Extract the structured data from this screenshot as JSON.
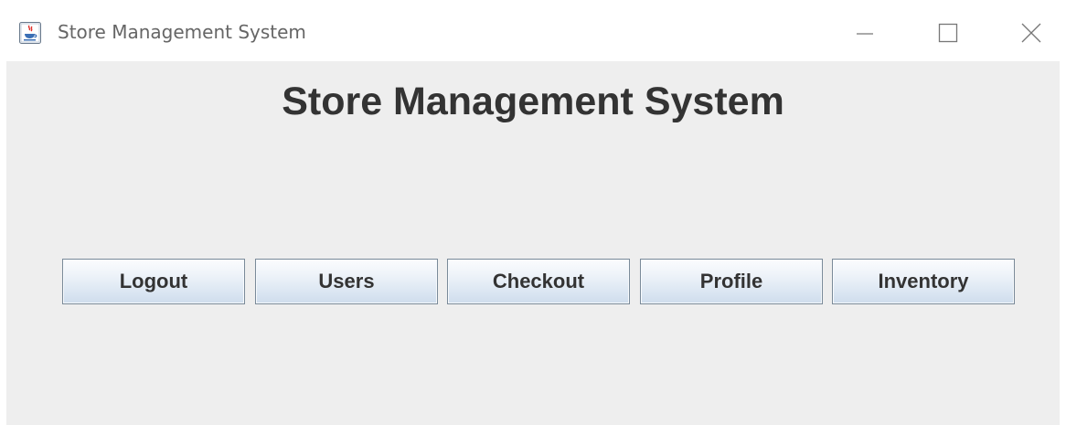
{
  "window": {
    "title": "Store Management System",
    "app_icon": "java-icon",
    "controls": {
      "minimize": "minimize-icon",
      "maximize": "maximize-icon",
      "close": "close-icon"
    }
  },
  "main": {
    "heading": "Store Management System",
    "buttons": [
      {
        "label": "Logout"
      },
      {
        "label": "Users"
      },
      {
        "label": "Checkout"
      },
      {
        "label": "Profile"
      },
      {
        "label": "Inventory"
      }
    ]
  },
  "colors": {
    "content_background": "#eeeeee",
    "button_border": "#7a8a99",
    "text": "#333333"
  }
}
